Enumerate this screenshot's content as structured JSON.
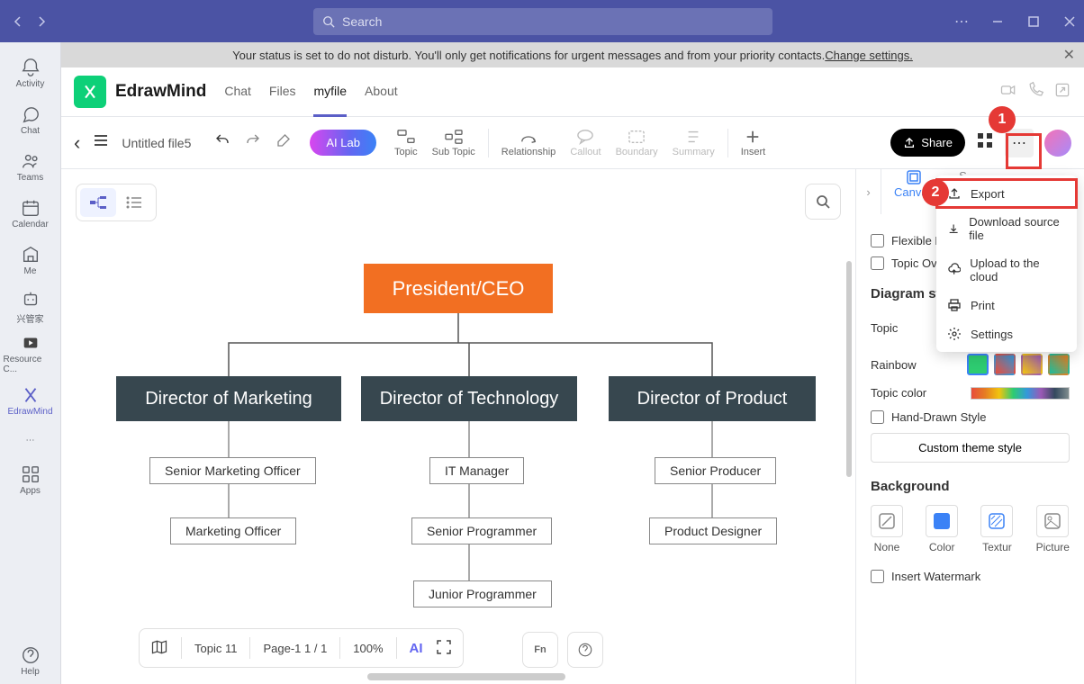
{
  "titlebar": {
    "search_placeholder": "Search"
  },
  "rail": {
    "items": [
      {
        "label": "Activity"
      },
      {
        "label": "Chat"
      },
      {
        "label": "Teams"
      },
      {
        "label": "Calendar"
      },
      {
        "label": "Me"
      },
      {
        "label": "兴管家"
      },
      {
        "label": "Resource C..."
      },
      {
        "label": "EdrawMind"
      }
    ],
    "apps": "Apps",
    "help": "Help"
  },
  "status": {
    "text": "Your status is set to do not disturb. You'll only get notifications for urgent messages and from your priority contacts. ",
    "link": "Change settings."
  },
  "header": {
    "app_name": "EdrawMind",
    "tabs": [
      "Chat",
      "Files",
      "myfile",
      "About"
    ],
    "active": "myfile"
  },
  "toolbar": {
    "file": "Untitled file5",
    "ai": "AI Lab",
    "tools": [
      "Topic",
      "Sub Topic",
      "Relationship",
      "Callout",
      "Boundary",
      "Summary",
      "Insert"
    ],
    "share": "Share"
  },
  "dropdown": {
    "items": [
      "Export",
      "Download source file",
      "Upload to the cloud",
      "Print",
      "Settings"
    ],
    "highlight": "Export"
  },
  "panel": {
    "tab": "Canvas",
    "flexible": "Flexible F",
    "overlap": "Topic Ove",
    "diagram_h": "Diagram style",
    "topic": "Topic",
    "rainbow": "Rainbow",
    "topic_color": "Topic color",
    "hand": "Hand-Drawn Style",
    "custom": "Custom theme style",
    "bg_h": "Background",
    "bg_opts": [
      "None",
      "Color",
      "Textur",
      "Picture"
    ],
    "watermark": "Insert Watermark"
  },
  "chart": {
    "ceo": "President/CEO",
    "dirs": [
      "Director of Marketing",
      "Director of Technology",
      "Director of Product"
    ],
    "subs": [
      "Senior Marketing Officer",
      "Marketing Officer",
      "IT Manager",
      "Senior Programmer",
      "Junior Programmer",
      "Senior Producer",
      "Product Designer"
    ]
  },
  "bottom": {
    "topic": "Topic 11",
    "page": "Page-1  1 / 1",
    "zoom": "100%"
  },
  "badges": {
    "b1": "1",
    "b2": "2"
  }
}
